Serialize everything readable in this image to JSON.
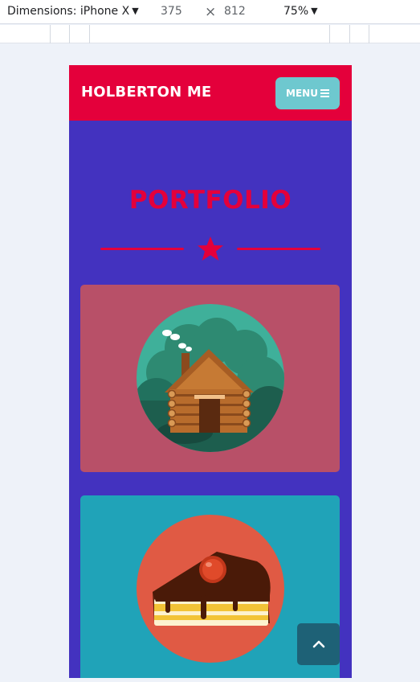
{
  "devtools": {
    "device_label": "Dimensions: iPhone X",
    "width": "375",
    "times": "×",
    "height": "812",
    "zoom": "75%"
  },
  "site": {
    "brand": "HOLBERTON ME",
    "menu_label": "MENU"
  },
  "portfolio": {
    "title": "PORTFOLIO",
    "items": [
      {
        "icon": "log-cabin-icon",
        "background": "#b85068"
      },
      {
        "icon": "cake-slice-icon",
        "background": "#20a3b8"
      }
    ]
  },
  "colors": {
    "brand_red": "#e4003b",
    "page_purple": "#4332bf",
    "menu_teal": "#6ec8cf",
    "back_to_top": "#1e6176"
  }
}
